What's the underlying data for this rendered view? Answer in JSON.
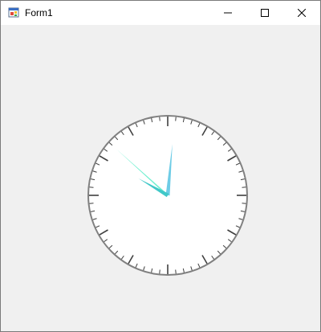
{
  "window": {
    "title": "Form1",
    "icon": "winforms-app-icon",
    "controls": {
      "minimize_icon": "minimize-icon",
      "maximize_icon": "maximize-icon",
      "close_icon": "close-icon"
    }
  },
  "clock": {
    "hours": 10,
    "minutes": 0,
    "seconds": 52,
    "colors": {
      "face": "#ffffff",
      "rim": "#808080",
      "ticks": "#404040",
      "hour_hand": "#40c8c8",
      "minute_hand": "#6ecce6",
      "second_hand": "#6ef0d0"
    }
  }
}
